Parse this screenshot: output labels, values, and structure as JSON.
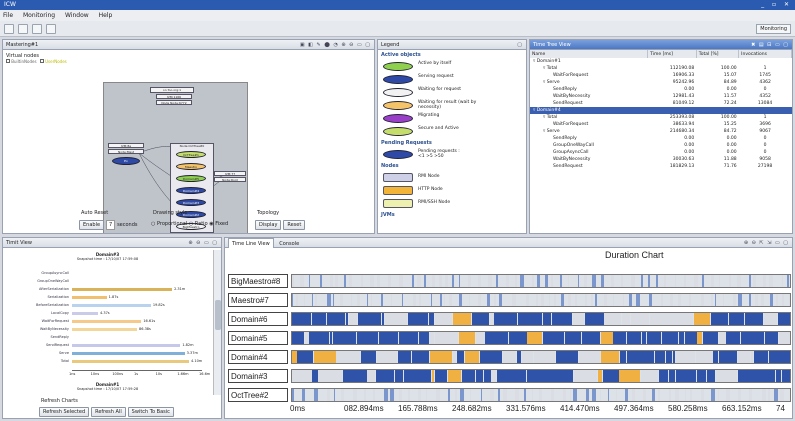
{
  "window": {
    "title": "ICW",
    "controls": "_ ▫ ✕"
  },
  "menu": [
    "File",
    "Monitoring",
    "Window",
    "Help"
  ],
  "toolbar": {
    "perspective": "Monitoring"
  },
  "mastering": {
    "tab": "Mastering#1",
    "virtual_nodes": "Virtual nodes",
    "legend_items": [
      "BuiltinNodes",
      "UserNodes"
    ],
    "nodes": {
      "n1": "on foo.org:1",
      "n2": "JVM:1166",
      "n3": "Node Node:6772",
      "n4": "Node:OctTree#0",
      "n5": "JVM:8a",
      "n6": "Node:Mast",
      "n7": "JVM:77",
      "n8": "Node:Root",
      "e1": "OctTree#1",
      "e2": "Maestro",
      "e3": "Domain#5",
      "e4": "Domain#4",
      "e5": "Domain#3",
      "e6": "Domain#2",
      "e7": "BigMaestro",
      "ex": "Ex"
    },
    "auto_reset": "Auto Reset",
    "enable": "Enable",
    "seconds_value": "7",
    "seconds": "seconds",
    "drawing_style": "Drawing style",
    "styles": [
      "Proportional",
      "Ratio",
      "Fixed"
    ],
    "topology": "Topology",
    "display": "Display",
    "reset": "Reset"
  },
  "legend": {
    "tab": "Legend",
    "active_objects": "Active objects",
    "items": [
      {
        "label": "Active by itself",
        "color": "#8fd14f"
      },
      {
        "label": "Serving request",
        "color": "#2e4aa6"
      },
      {
        "label": "Waiting for request",
        "color": "#f2f2f2"
      },
      {
        "label": "Waiting for result (wait by necessity)",
        "color": "#f5c469"
      },
      {
        "label": "Migrating",
        "color": "#9a3fc7"
      },
      {
        "label": "Secure and Active",
        "color": "#c5dd6b"
      }
    ],
    "pending_requests": "Pending Requests",
    "pending_label": "Pending requests :",
    "pending_values": "<1   >5   >50",
    "nodes": "Nodes",
    "node_items": [
      {
        "label": "RMI Node",
        "color": "#cdd0e6"
      },
      {
        "label": "HTTP Node",
        "color": "#f3b43a"
      },
      {
        "label": "RMI/SSH Node",
        "color": "#eef0b0"
      }
    ],
    "jvms": "JVMs"
  },
  "timetree": {
    "tab": "Time Tree View",
    "columns": [
      "Name",
      "Time [ms]",
      "Total [%]",
      "Invocations"
    ],
    "rows": [
      {
        "name": "Domain#1",
        "time": "",
        "total": "",
        "inv": "",
        "indent": 0
      },
      {
        "name": "Total",
        "time": "112190.08",
        "total": "100.00",
        "inv": "1",
        "indent": 1
      },
      {
        "name": "WaitForRequest",
        "time": "16906.33",
        "total": "15.07",
        "inv": "1745",
        "indent": 2
      },
      {
        "name": "Serve",
        "time": "95242.96",
        "total": "84.89",
        "inv": "4362",
        "indent": 1
      },
      {
        "name": "SendReply",
        "time": "0.00",
        "total": "0.00",
        "inv": "0",
        "indent": 2
      },
      {
        "name": "WaitByNecessity",
        "time": "12981.43",
        "total": "11.57",
        "inv": "4352",
        "indent": 2
      },
      {
        "name": "SendRequest",
        "time": "81049.12",
        "total": "72.24",
        "inv": "13084",
        "indent": 2
      },
      {
        "name": "Domain#4",
        "time": "",
        "total": "",
        "inv": "",
        "indent": 0,
        "selected": true
      },
      {
        "name": "Total",
        "time": "253393.08",
        "total": "100.00",
        "inv": "1",
        "indent": 1
      },
      {
        "name": "WaitForRequest",
        "time": "38633.94",
        "total": "15.25",
        "inv": "3696",
        "indent": 2
      },
      {
        "name": "Serve",
        "time": "214680.34",
        "total": "84.72",
        "inv": "9067",
        "indent": 1
      },
      {
        "name": "SendReply",
        "time": "0.00",
        "total": "0.00",
        "inv": "0",
        "indent": 2
      },
      {
        "name": "GroupOneWayCall",
        "time": "0.00",
        "total": "0.00",
        "inv": "0",
        "indent": 2
      },
      {
        "name": "GroupAsyncCall",
        "time": "0.00",
        "total": "0.00",
        "inv": "0",
        "indent": 2
      },
      {
        "name": "WaitByNecessity",
        "time": "30030.63",
        "total": "11.88",
        "inv": "9058",
        "indent": 2
      },
      {
        "name": "SendRequest",
        "time": "181829.13",
        "total": "71.76",
        "inv": "27198",
        "indent": 2
      }
    ]
  },
  "timitview": {
    "tab": "Timit View",
    "chart_data": {
      "type": "bar",
      "title": "Domain#3",
      "subtitle": "Snapshot time : 17/10/07 17:59:08",
      "categories": [
        "GroupAsyncCall",
        "GroupOneWayCall",
        "AfterSerialization",
        "Serialization",
        "BeforeSerialization",
        "LocalCopy",
        "WaitForRequest",
        "WaitByNecessity",
        "SendReply",
        "SendRequest",
        "Serve",
        "Total"
      ],
      "series": [
        {
          "values": [
            0,
            0,
            2.31,
            0.8,
            1.82,
            0.6,
            1.6,
            1.5,
            0,
            2.5,
            2.6,
            2.7
          ]
        }
      ],
      "value_labels": [
        "",
        "",
        "2.31m",
        "1.87s",
        "19.82s",
        "4.37s",
        "16.61s",
        "86.38s",
        "",
        "1.82m",
        "3.37m",
        "4.10m"
      ],
      "xticks": [
        "1ns",
        "10ns",
        "100ns",
        "1s",
        "10s",
        "1.66m",
        "16.6m"
      ],
      "second_title": "Domain#1",
      "second_subtitle": "Snapshot time : 17/10/07 17:59:28"
    },
    "refresh_charts": "Refresh Charts",
    "refresh_selected": "Refresh Selected",
    "refresh_all": "Refresh All",
    "switch_to_basic": "Switch To Basic"
  },
  "timeline": {
    "tab": "Time Line View",
    "tab2": "Console",
    "title": "Duration Chart",
    "lanes": [
      "BigMaestro#8",
      "Maestro#7",
      "Domain#6",
      "Domain#5",
      "Domain#4",
      "Domain#3",
      "OctTree#2"
    ],
    "ticks": [
      "0ms",
      "082.894ms",
      "165.788ms",
      "248.682ms",
      "331.576ms",
      "414.470ms",
      "497.364ms",
      "580.258ms",
      "663.152ms",
      "74"
    ],
    "colors": {
      "serve": "#2f53a8",
      "wait": "#f0b042",
      "idle": "#dadde4"
    }
  }
}
